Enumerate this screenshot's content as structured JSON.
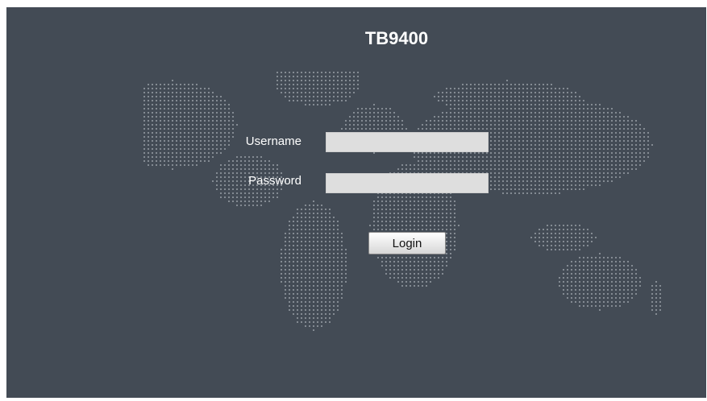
{
  "app": {
    "title": "TB9400"
  },
  "login_form": {
    "username_label": "Username",
    "username_value": "",
    "password_label": "Password",
    "password_value": "",
    "login_label": "Login"
  },
  "colors": {
    "background": "#434b55",
    "map_dots": "#9aa0a8",
    "field_background": "#dedede"
  },
  "icons": {
    "background_map": "world-map-dots-icon"
  }
}
